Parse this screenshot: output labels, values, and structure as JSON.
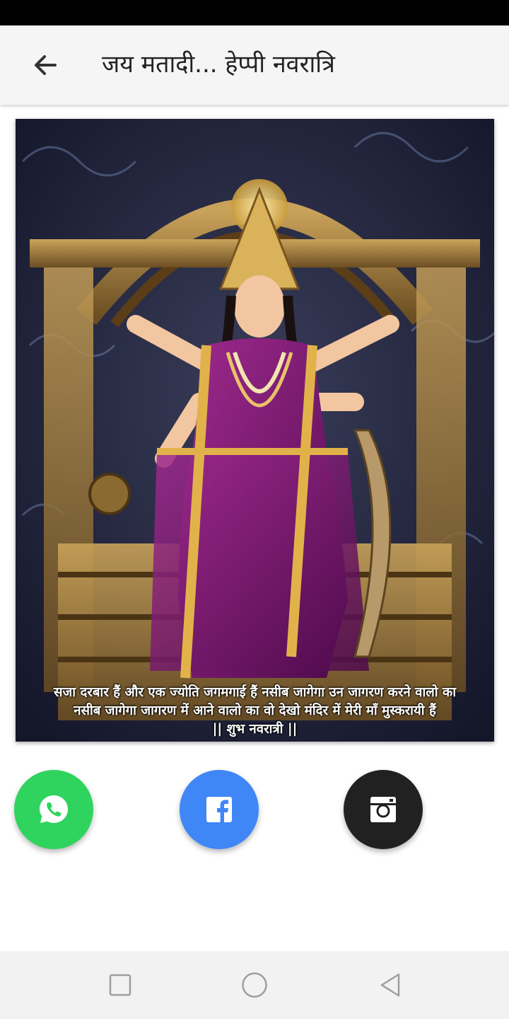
{
  "app_bar": {
    "title": "जय मतादी... हेप्पी नवरात्रि",
    "back_icon": "arrow-left-icon"
  },
  "image": {
    "caption_line1": "सजा दरबार हैं और एक ज्योति जगमगाई हैं नसीब जागेगा उन जागरण करने वालो का",
    "caption_line2": "नसीब जागेगा जागरण में आने वालो का वो देखो मंदिर में मेरी माँ मुस्करायी हैं",
    "caption_line3": "|| शुभ नवरात्री ||"
  },
  "share": {
    "whatsapp": {
      "icon": "whatsapp-icon",
      "color": "#2fd45e"
    },
    "facebook": {
      "icon": "facebook-icon",
      "color": "#3f86f7"
    },
    "instagram": {
      "icon": "instagram-icon",
      "color": "#212121"
    }
  },
  "nav": {
    "recents_icon": "square-icon",
    "home_icon": "circle-icon",
    "back_icon": "triangle-back-icon"
  }
}
